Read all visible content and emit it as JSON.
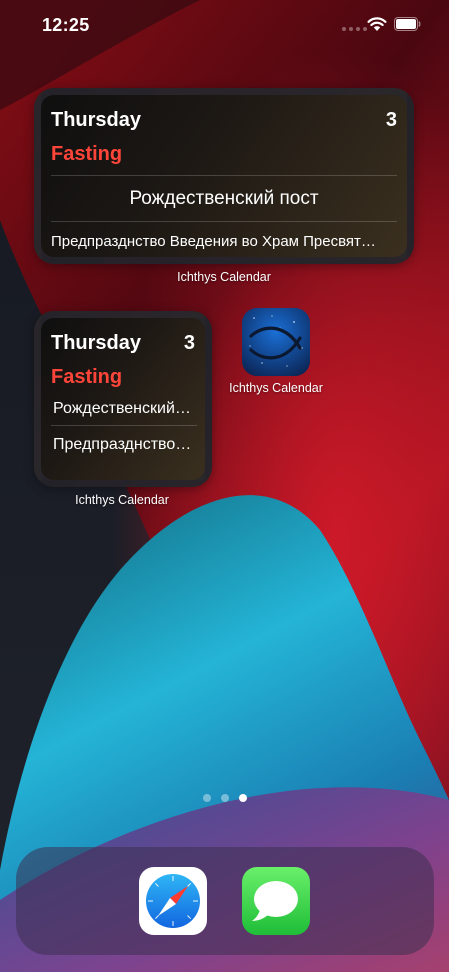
{
  "status_bar": {
    "time": "12:25"
  },
  "widgets": {
    "medium": {
      "day": "Thursday",
      "date": "3",
      "fasting": "Fasting",
      "line1": "Рождественский пост",
      "line2": "Предпразднство Введения во Храм Пресвят…",
      "label": "Ichthys Calendar"
    },
    "small": {
      "day": "Thursday",
      "date": "3",
      "fasting": "Fasting",
      "line1": "Рождественский…",
      "line2": "Предпразднство…",
      "label": "Ichthys Calendar"
    }
  },
  "apps": {
    "ichthys": {
      "label": "Ichthys Calendar",
      "icon": "ichthys-fish-icon"
    }
  },
  "page_indicator": {
    "pages": 3,
    "current": 3
  },
  "dock": {
    "apps": [
      {
        "icon": "safari-compass-icon"
      },
      {
        "icon": "messages-bubble-icon"
      }
    ]
  },
  "colors": {
    "fasting": "#ff453a",
    "accent_blue": "#1a6fd6"
  }
}
